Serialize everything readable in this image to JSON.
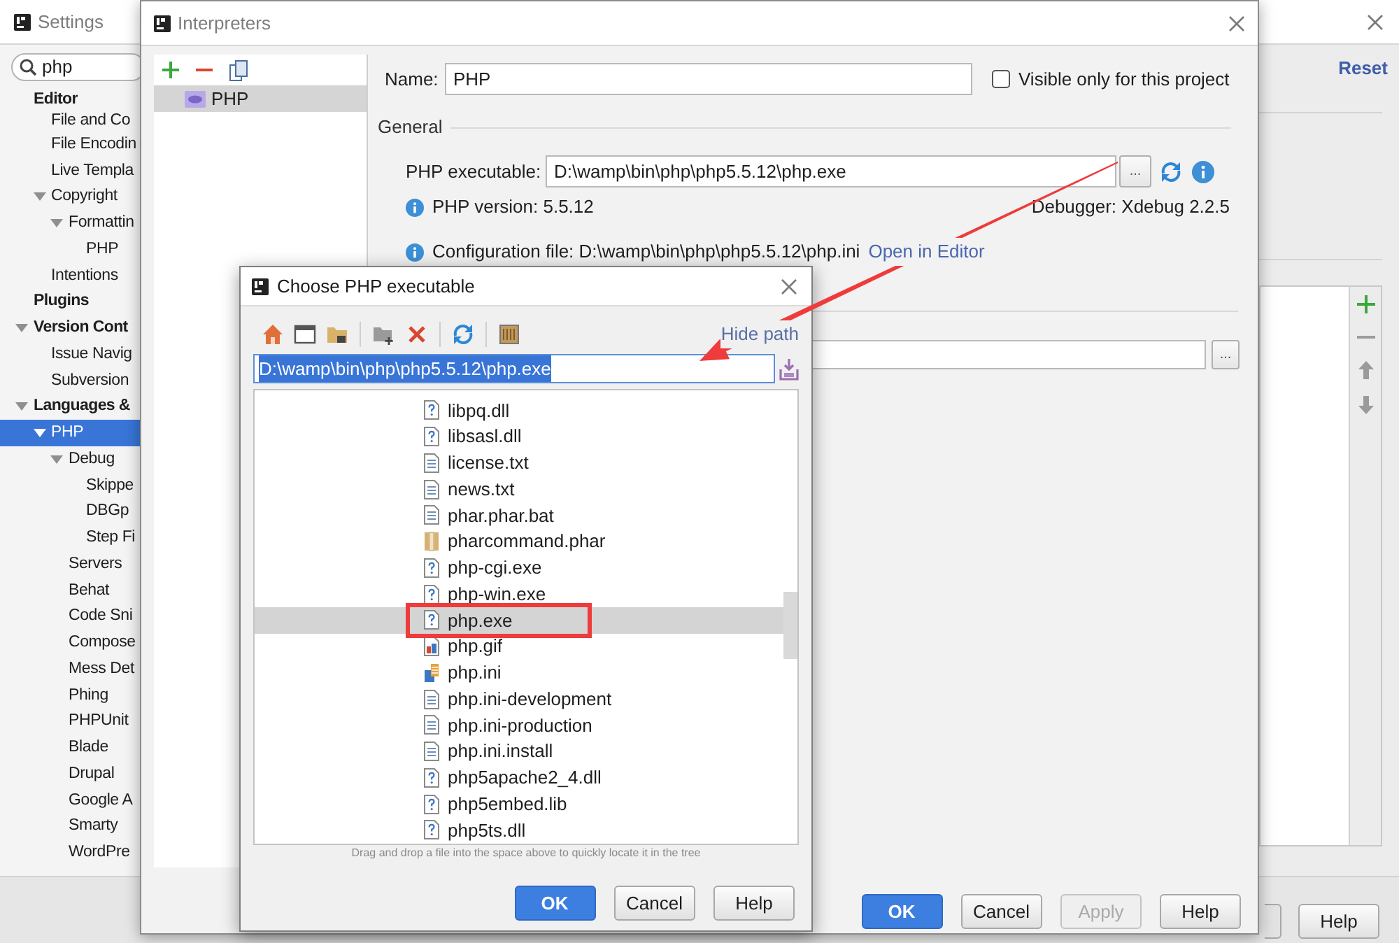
{
  "settings_window": {
    "title": "Settings",
    "active": false,
    "search": {
      "value": "php"
    },
    "sidebar": [
      {
        "label": "Editor",
        "selected": false,
        "children": [
          {
            "label": "File and Co",
            "selected": false
          },
          {
            "label": "File Encodin",
            "selected": false
          },
          {
            "label": "Live Templa",
            "selected": false
          },
          {
            "label": "Copyright",
            "selected": false,
            "expanded": true,
            "children": [
              {
                "label": "Formattin",
                "selected": false,
                "expanded": true,
                "children": [
                  {
                    "label": "PHP",
                    "selected": false
                  }
                ]
              }
            ]
          },
          {
            "label": "Intentions",
            "selected": false
          }
        ]
      },
      {
        "label": "Plugins",
        "selected": false
      },
      {
        "label": "Version Cont",
        "selected": false,
        "expanded": true,
        "children": [
          {
            "label": "Issue Navig",
            "selected": false
          },
          {
            "label": "Subversion",
            "selected": false
          }
        ]
      },
      {
        "label": "Languages &",
        "selected": false,
        "expanded": true,
        "children": [
          {
            "label": "PHP",
            "selected": true,
            "expanded": true,
            "children": [
              {
                "label": "Debug",
                "selected": false,
                "expanded": true,
                "children": [
                  {
                    "label": "Skippe",
                    "selected": false
                  },
                  {
                    "label": "DBGp",
                    "selected": false
                  },
                  {
                    "label": "Step Fi",
                    "selected": false
                  }
                ]
              },
              {
                "label": "Servers",
                "selected": false
              },
              {
                "label": "Behat",
                "selected": false
              },
              {
                "label": "Code Sni",
                "selected": false
              },
              {
                "label": "Compose",
                "selected": false
              },
              {
                "label": "Mess Det",
                "selected": false
              },
              {
                "label": "Phing",
                "selected": false
              },
              {
                "label": "PHPUnit",
                "selected": false
              },
              {
                "label": "Blade",
                "selected": false
              },
              {
                "label": "Drupal",
                "selected": false
              },
              {
                "label": "Google A",
                "selected": false
              },
              {
                "label": "Smarty",
                "selected": false
              },
              {
                "label": "WordPre",
                "selected": false
              }
            ]
          }
        ]
      }
    ],
    "reset_link": "Reset",
    "buttons": [
      {
        "label": "Help",
        "kind": "normal",
        "disabled": false
      }
    ]
  },
  "interpreters_dialog": {
    "title": "Interpreters",
    "active": false,
    "interpreters": [
      {
        "name": "PHP",
        "selected": true
      }
    ],
    "name_label": "Name:",
    "name_value": "PHP",
    "visible_only": {
      "label": "Visible only for this project",
      "checked": false
    },
    "general_heading": "General",
    "executable": {
      "label": "PHP executable:",
      "value": "D:\\wamp\\bin\\php\\php5.5.12\\php.exe",
      "browse": "..."
    },
    "php_version": "PHP version: 5.5.12",
    "debugger": "Debugger: Xdebug 2.2.5",
    "config_file": "Configuration file: D:\\wamp\\bin\\php\\php5.5.12\\php.ini",
    "open_in_editor": "Open in Editor",
    "include_browse": "...",
    "buttons": [
      {
        "label": "OK",
        "kind": "primary",
        "disabled": false
      },
      {
        "label": "Cancel",
        "kind": "normal",
        "disabled": false
      },
      {
        "label": "Apply",
        "kind": "normal",
        "disabled": true
      },
      {
        "label": "Help",
        "kind": "normal",
        "disabled": false
      }
    ]
  },
  "choose_dialog": {
    "title": "Choose PHP executable",
    "active": true,
    "hide_path": "Hide path",
    "path": {
      "value": "D:\\wamp\\bin\\php\\php5.5.12\\php.exe",
      "text_selected": true
    },
    "files": [
      {
        "name": "libpq.dll",
        "kind": "unknown",
        "selected": false
      },
      {
        "name": "libsasl.dll",
        "kind": "unknown",
        "selected": false
      },
      {
        "name": "license.txt",
        "kind": "text",
        "selected": false
      },
      {
        "name": "news.txt",
        "kind": "text",
        "selected": false
      },
      {
        "name": "phar.phar.bat",
        "kind": "text",
        "selected": false
      },
      {
        "name": "pharcommand.phar",
        "kind": "archive",
        "selected": false
      },
      {
        "name": "php-cgi.exe",
        "kind": "unknown",
        "selected": false
      },
      {
        "name": "php-win.exe",
        "kind": "unknown",
        "selected": false
      },
      {
        "name": "php.exe",
        "kind": "unknown",
        "selected": true
      },
      {
        "name": "php.gif",
        "kind": "image",
        "selected": false
      },
      {
        "name": "php.ini",
        "kind": "config",
        "selected": false
      },
      {
        "name": "php.ini-development",
        "kind": "text",
        "selected": false
      },
      {
        "name": "php.ini-production",
        "kind": "text",
        "selected": false
      },
      {
        "name": "php.ini.install",
        "kind": "text",
        "selected": false
      },
      {
        "name": "php5apache2_4.dll",
        "kind": "unknown",
        "selected": false
      },
      {
        "name": "php5embed.lib",
        "kind": "unknown",
        "selected": false
      },
      {
        "name": "php5ts.dll",
        "kind": "unknown",
        "selected": false
      }
    ],
    "hint": "Drag and drop a file into the space above to quickly locate it in the tree",
    "buttons": [
      {
        "label": "OK",
        "kind": "primary",
        "disabled": false
      },
      {
        "label": "Cancel",
        "kind": "normal",
        "disabled": false
      },
      {
        "label": "Help",
        "kind": "normal",
        "disabled": false
      }
    ]
  }
}
